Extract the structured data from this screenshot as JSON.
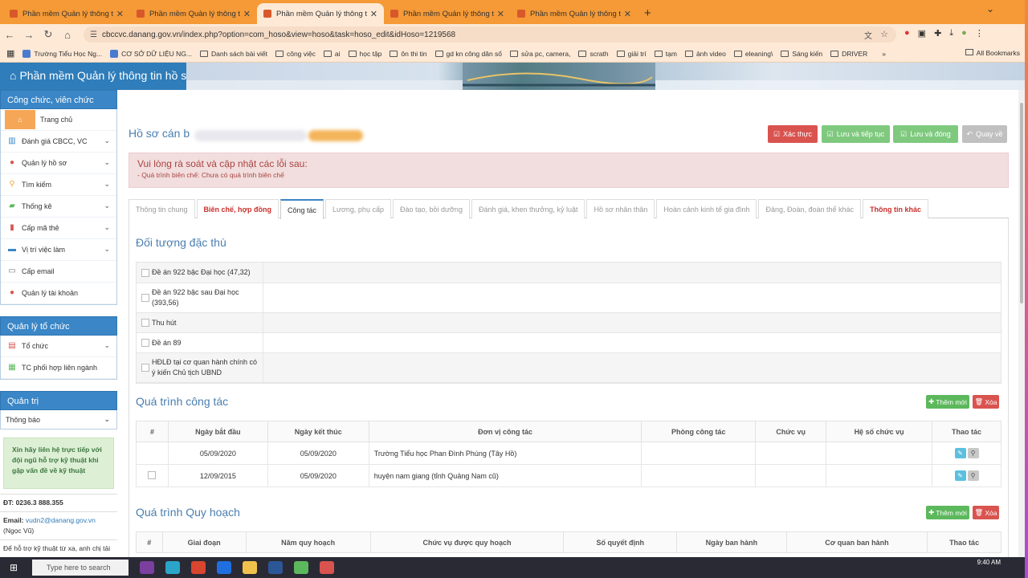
{
  "browser": {
    "tabs": [
      {
        "title": "Phần mềm Quản lý thông tin h",
        "active": false
      },
      {
        "title": "Phần mềm Quản lý thông tin h",
        "active": false
      },
      {
        "title": "Phần mềm Quản lý thông tin h",
        "active": true
      },
      {
        "title": "Phần mềm Quản lý thông tin h",
        "active": false
      },
      {
        "title": "Phần mềm Quản lý thông tin h",
        "active": false
      }
    ],
    "url": "cbccvc.danang.gov.vn/index.php?option=com_hoso&view=hoso&task=hoso_edit&idHoso=1219568",
    "bookmarks": [
      "Trường Tiểu Học Ng...",
      "CƠ SỞ DỮ LIỆU NG...",
      "Danh sách bài viết",
      "công việc",
      "ai",
      "học tập",
      "ôn thi tin",
      "gd kn công dân số",
      "sửa pc, camera,",
      "scrath",
      "giải trí",
      "tạm",
      "ảnh video",
      "eleaning\\",
      "Sáng kiến",
      "DRIVER"
    ],
    "all_bookmarks": "All Bookmarks"
  },
  "app": {
    "title": "Phần mềm Quản lý thông tin hồ s"
  },
  "sidebar": {
    "group1": {
      "title": "Công chức, viên chức",
      "items": [
        {
          "label": "Trang chủ"
        },
        {
          "label": "Đánh giá CBCC, VC"
        },
        {
          "label": "Quản lý hồ sơ"
        },
        {
          "label": "Tìm kiếm"
        },
        {
          "label": "Thống kê"
        },
        {
          "label": "Cấp mã thẻ"
        },
        {
          "label": "Vị trí việc làm"
        },
        {
          "label": "Cấp email"
        },
        {
          "label": "Quản lý tài khoản"
        }
      ]
    },
    "group2": {
      "title": "Quản lý tổ chức",
      "items": [
        {
          "label": "Tổ chức"
        },
        {
          "label": "TC phối hợp liên ngành"
        }
      ]
    },
    "group3": {
      "title": "Quản trị",
      "select": "Thông báo"
    },
    "support": "Xin hãy liên hệ trực tiếp với đội ngũ hỗ trợ kỹ thuật khi gặp vấn đề về kỹ thuật",
    "phone": "ĐT: 0236.3 888.355",
    "email_label": "Email:",
    "email": "vudn2@danang.gov.vn",
    "email_name": "(Ngọc Vũ)",
    "remote": "Để hỗ trợ kỹ thuật từ xa, anh chị tải"
  },
  "page": {
    "title": "Hồ sơ cán b",
    "buttons": {
      "verify": "Xác thực",
      "save_continue": "Lưu và tiếp tục",
      "save_close": "Lưu và đóng",
      "back": "Quay về"
    },
    "alert": {
      "heading": "Vui lòng rà soát và cập nhật các lỗi sau:",
      "detail": "- Quá trình biên chế: Chưa có quá trình biên chế"
    },
    "tabs": [
      {
        "label": "Thông tin chung",
        "state": "normal"
      },
      {
        "label": "Biên chế, hợp đồng",
        "state": "error"
      },
      {
        "label": "Công tác",
        "state": "active"
      },
      {
        "label": "Lương, phụ cấp",
        "state": "normal"
      },
      {
        "label": "Đào tạo, bồi dưỡng",
        "state": "normal"
      },
      {
        "label": "Đánh giá, khen thưởng, kỷ luật",
        "state": "normal"
      },
      {
        "label": "Hồ sơ nhân thân",
        "state": "normal"
      },
      {
        "label": "Hoàn cảnh kinh tế gia đình",
        "state": "normal"
      },
      {
        "label": "Đảng, Đoàn, đoàn thể khác",
        "state": "normal"
      },
      {
        "label": "Thông tin khác",
        "state": "error"
      }
    ],
    "special": {
      "title": "Đối tượng đặc thù",
      "rows": [
        {
          "label": "Đề án 922 bậc Đại học (47,32)"
        },
        {
          "label": "Đề án 922 bậc sau Đại học (393,56)"
        },
        {
          "label": "Thu hút"
        },
        {
          "label": "Đề án 89"
        },
        {
          "label": "HĐLĐ tại cơ quan hành chính có ý kiến Chủ tịch UBND"
        }
      ]
    },
    "work": {
      "title": "Quá trình công tác",
      "add": "Thêm mới",
      "delete": "Xóa",
      "headers": [
        "#",
        "Ngày bắt đầu",
        "Ngày kết thúc",
        "Đơn vị công tác",
        "Phòng công tác",
        "Chức vụ",
        "Hệ số chức vụ",
        "Thao tác"
      ],
      "rows": [
        {
          "start": "05/09/2020",
          "end": "05/09/2020",
          "unit": "Trường Tiểu học Phan Đình Phùng (Tây Hồ)",
          "dept": "",
          "position": "",
          "coef": ""
        },
        {
          "start": "12/09/2015",
          "end": "05/09/2020",
          "unit": "huyện nam giang (tỉnh Quảng Nam cũ)",
          "dept": "",
          "position": "",
          "coef": ""
        }
      ]
    },
    "planning": {
      "title": "Quá trình Quy hoạch",
      "add": "Thêm mới",
      "delete": "Xóa",
      "headers": [
        "#",
        "Giai đoạn",
        "Năm quy hoạch",
        "Chức vụ được quy hoạch",
        "Số quyết định",
        "Ngày ban hành",
        "Cơ quan ban hành",
        "Thao tác"
      ]
    }
  },
  "taskbar": {
    "search": "Type here to search",
    "time": "9:40 AM"
  },
  "colors": {
    "primary": "#2f7dba",
    "danger": "#d9534f",
    "success": "#5cb85c",
    "alert_bg": "#f2dede"
  }
}
